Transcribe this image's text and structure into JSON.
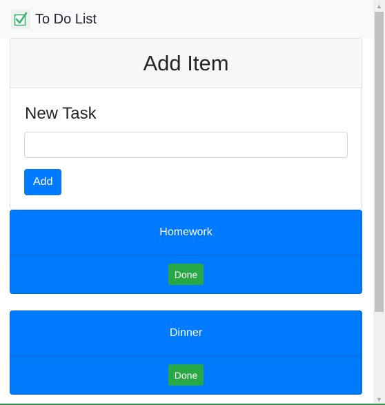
{
  "navbar": {
    "title": "To Do List",
    "logo_icon": "green-checkbox-icon",
    "logo_color": "#3cb371"
  },
  "add_card": {
    "header": "Add Item",
    "form_label": "New Task",
    "input_value": "",
    "input_placeholder": "",
    "add_button_label": "Add"
  },
  "items": [
    {
      "title": "Homework",
      "done_label": "Done"
    },
    {
      "title": "Dinner",
      "done_label": "Done"
    }
  ],
  "colors": {
    "primary": "#007bff",
    "success": "#28a745",
    "navbar_bg": "#f8f9fa"
  }
}
